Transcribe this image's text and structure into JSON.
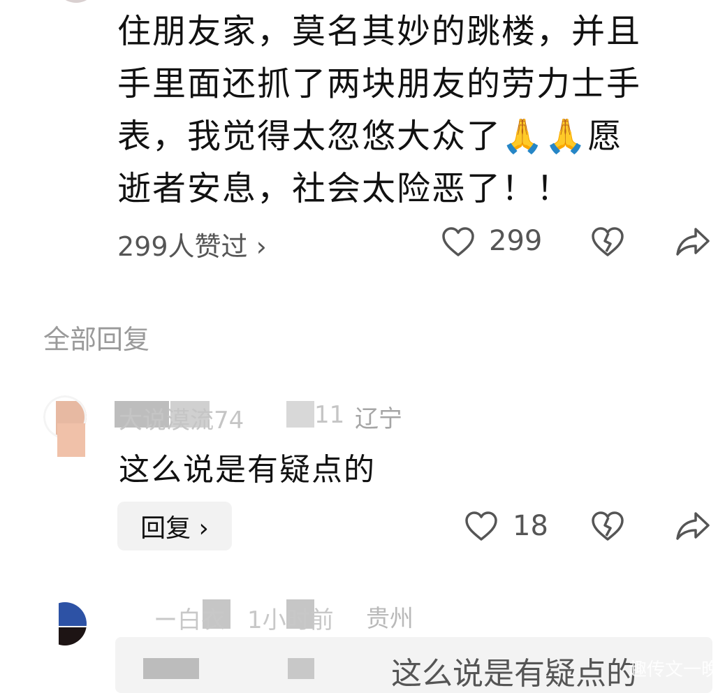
{
  "main_comment": {
    "text": "住朋友家，莫名其妙的跳楼，并且\n手里面还抓了两块朋友的劳力士手\n表，我觉得太忽悠大众了🙏🙏愿\n逝者安息，社会太险恶了！！",
    "likes_summary": "299人赞过 ›",
    "like_count": "299"
  },
  "section_title": "全部回复",
  "replies": [
    {
      "username_partial": "大说漠流74",
      "time_partial": "11",
      "location": "辽宁",
      "text": "这么说是有疑点的",
      "reply_label": "回复 ›",
      "like_count": "18"
    },
    {
      "username_partial": "ー白衣",
      "time_partial": "1小时前",
      "location": "贵州",
      "quoted_text": "这么说是有疑点的"
    }
  ],
  "watermark": "趣传文一晚",
  "icons": {
    "like": "heart-outline-icon",
    "dislike": "broken-heart-icon",
    "share": "share-arrow-icon",
    "emoji": "folded-hands-emoji"
  },
  "colors": {
    "text_primary": "#111111",
    "text_secondary": "#555555",
    "text_muted": "#9a9a9a",
    "reply_bg": "#f2f2f2"
  }
}
